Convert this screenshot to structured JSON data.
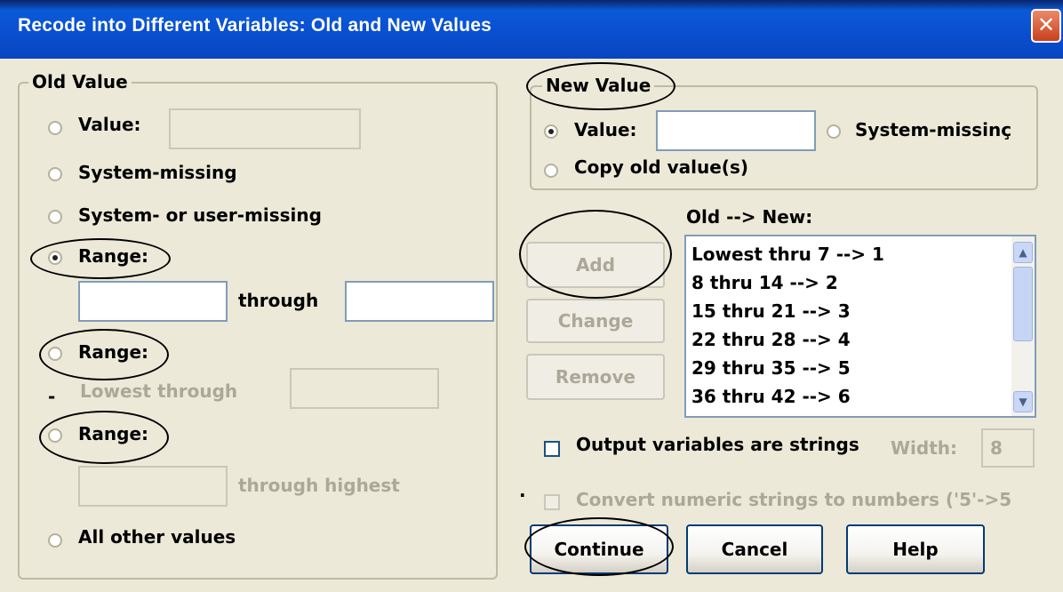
{
  "window": {
    "title": "Recode into Different Variables: Old and New Values"
  },
  "old_value": {
    "group_label": "Old Value",
    "value_label": "Value:",
    "system_missing_label": "System-missing",
    "system_or_user_missing_label": "System- or user-missing",
    "range1_label": "Range:",
    "through_label": "through",
    "range2_label": "Range:",
    "lowest_through_label": "Lowest through",
    "range3_label": "Range:",
    "through_highest_label": "through highest",
    "all_other_label": "All other values",
    "selected": "range1"
  },
  "new_value": {
    "group_label": "New Value",
    "value_label": "Value:",
    "system_missing_label": "System-missinç",
    "copy_old_label": "Copy old value(s)",
    "selected": "value"
  },
  "mapping": {
    "header": "Old --> New:",
    "items": [
      "Lowest thru 7 --> 1",
      "8 thru 14 --> 2",
      "15 thru 21 --> 3",
      "22 thru 28 --> 4",
      "29 thru 35 --> 5",
      "36 thru 42 --> 6"
    ]
  },
  "buttons": {
    "add": "Add",
    "change": "Change",
    "remove": "Remove",
    "continue": "Continue",
    "cancel": "Cancel",
    "help": "Help"
  },
  "options": {
    "output_strings_label": "Output variables are strings",
    "width_label": "Width:",
    "width_value": "8",
    "convert_label": "Convert numeric strings to numbers ('5'->5"
  },
  "annotations": {
    "stray_dash": "-",
    "stray_dot": "."
  }
}
